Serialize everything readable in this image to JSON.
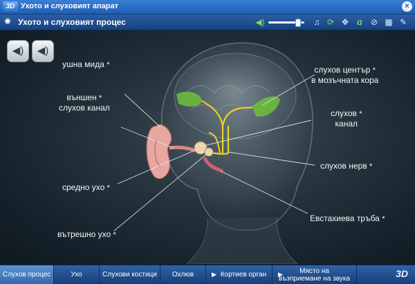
{
  "window": {
    "badge": "3D",
    "title": "Ухото и слуховият апарат",
    "close": "×"
  },
  "toolbar": {
    "heading": "Ухото и слуховият процес",
    "volume": 0.8,
    "icons": [
      "speaker-icon",
      "music-icon",
      "refresh-icon",
      "move-icon",
      "text-icon",
      "link-icon",
      "grid-icon",
      "wrench-icon"
    ]
  },
  "labels": {
    "ushna_mida": "ушна мида",
    "vanshen_1": "външен",
    "vanshen_2": "слухов канал",
    "sredno": "средно ухо",
    "vatreshno": "вътрешно ухо",
    "centar_1": "слухов център",
    "centar_2": "в мозъчната кора",
    "kanal_1": "слухов",
    "kanal_2": "канал",
    "nerv": "слухов нерв",
    "evstahieva": "Евстахиева тръба",
    "star": "*"
  },
  "tabs": [
    {
      "label": "Слухов процес",
      "active": true
    },
    {
      "label": "Ухо"
    },
    {
      "label": "Слухови костици"
    },
    {
      "label": "Охлюв"
    },
    {
      "label": "Кортиев орган"
    },
    {
      "label_1": "Място на",
      "label_2": "възприемане на звука"
    }
  ],
  "logo": "3D",
  "colors": {
    "accent": "#2c5ea4",
    "active_tab": "#4a80c4",
    "brain_green": "#6fc13a",
    "nerve_yellow": "#f2d21c",
    "ear_pink": "#e7a7a0"
  }
}
